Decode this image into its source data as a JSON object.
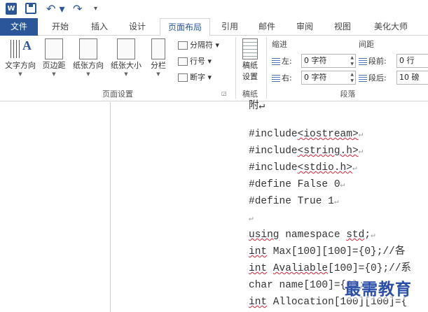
{
  "quick_access": {
    "app_icon": "word-icon",
    "app_letter": "W",
    "save_icon": "save-icon",
    "undo_label": "↶ ▾",
    "redo_label": "↷",
    "more_label": "▾"
  },
  "tabs": {
    "file": "文件",
    "home": "开始",
    "insert": "插入",
    "design": "设计",
    "layout": "页面布局",
    "references": "引用",
    "mailings": "邮件",
    "review": "审阅",
    "view": "视图",
    "meihua": "美化大师"
  },
  "ribbon": {
    "page_setup": {
      "text_direction": "文字方向",
      "margins": "页边距",
      "orientation": "纸张方向",
      "size": "纸张大小",
      "columns": "分栏",
      "breaks": "分隔符 ▾",
      "line_numbers": "行号 ▾",
      "hyphenation": "断字 ▾",
      "group_label": "页面设置"
    },
    "manuscript": {
      "button_line1": "稿纸",
      "button_line2": "设置",
      "group_label": "稿纸"
    },
    "paragraph": {
      "indent_title": "缩进",
      "spacing_title": "间距",
      "left_label": "左:",
      "left_value": "0 字符",
      "right_label": "右:",
      "right_value": "0 字符",
      "before_label": "段前:",
      "before_value": "0 行",
      "after_label": "段后:",
      "after_value": "10 磅",
      "group_label": "段落"
    }
  },
  "document": {
    "partial_top": "附↵",
    "lines": {
      "l1a": "#include",
      "l1b": "<iostream>",
      "l2a": "#include",
      "l2b": "<string.h>",
      "l3a": "#include",
      "l3b": "<stdio.h>",
      "l4": "#define False 0",
      "l5": "#define True 1",
      "l6": "",
      "l7a": "using",
      "l7b": " namespace ",
      "l7c": "std",
      "l7d": ";",
      "l8a": "int",
      "l8b": " Max[100][100]={0};//各",
      "l9a": "int",
      "l9b": " ",
      "l9c": "Avaliable",
      "l9d": "[100]={0};//系",
      "l10": "char name[100]={0};",
      "l11a": "int",
      "l11b": " Allocation[100][100]={"
    },
    "para_mark": "↵"
  },
  "watermark": "最需教育"
}
